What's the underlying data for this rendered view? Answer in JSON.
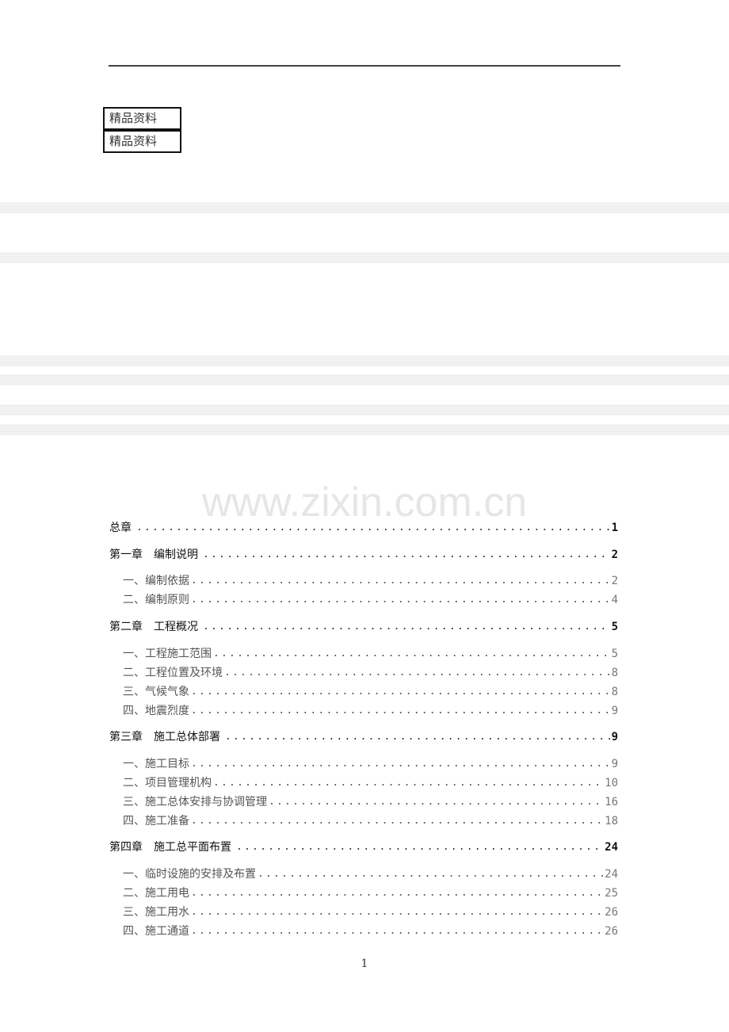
{
  "header": {
    "badges": [
      "精品资料",
      "精品资料"
    ]
  },
  "watermark": "www.zixin.com.cn",
  "toc": [
    {
      "level": "chapter",
      "label": "总章",
      "page": "1"
    },
    {
      "level": "chapter",
      "label": "第一章　编制说明",
      "page": "2"
    },
    {
      "level": "section",
      "label": "一、编制依据",
      "page": "2"
    },
    {
      "level": "section",
      "label": "二、编制原则",
      "page": "4"
    },
    {
      "level": "chapter",
      "label": "第二章　工程概况",
      "page": "5"
    },
    {
      "level": "section",
      "label": "一、工程施工范围",
      "page": "5"
    },
    {
      "level": "section",
      "label": "二、工程位置及环境",
      "page": "8"
    },
    {
      "level": "section",
      "label": "三、气候气象",
      "page": "8"
    },
    {
      "level": "section",
      "label": "四、地震烈度",
      "page": "9"
    },
    {
      "level": "chapter",
      "label": "第三章　施工总体部署",
      "page": "9"
    },
    {
      "level": "section",
      "label": "一、施工目标",
      "page": "9"
    },
    {
      "level": "section",
      "label": "二、项目管理机构",
      "page": "10"
    },
    {
      "level": "section",
      "label": "三、施工总体安排与协调管理",
      "page": "16"
    },
    {
      "level": "section",
      "label": "四、施工准备",
      "page": "18"
    },
    {
      "level": "chapter",
      "label": "第四章　施工总平面布置",
      "page": "24"
    },
    {
      "level": "section",
      "label": "一、临时设施的安排及布置",
      "page": "24"
    },
    {
      "level": "section",
      "label": "二、施工用电",
      "page": "25"
    },
    {
      "level": "section",
      "label": "三、施工用水",
      "page": "26"
    },
    {
      "level": "section",
      "label": "四、施工通道",
      "page": "26"
    }
  ],
  "footer": {
    "page_number": "1"
  }
}
